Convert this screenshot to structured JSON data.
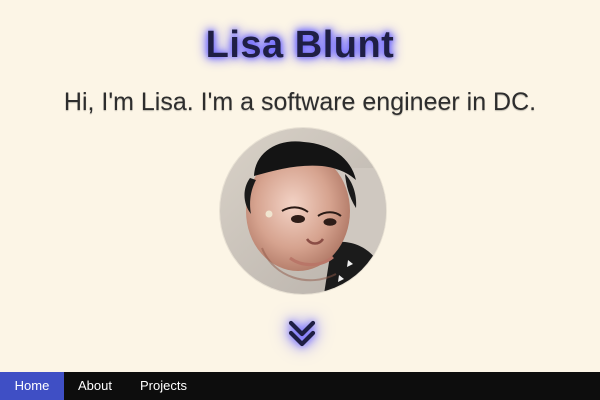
{
  "hero": {
    "name": "Lisa Blunt",
    "tagline": "Hi, I'm Lisa. I'm a software engineer in DC.",
    "avatar_alt": "Lisa Blunt",
    "scroll_icon": "double-chevron-down-icon"
  },
  "nav": {
    "items": [
      {
        "label": "Home",
        "active": true
      },
      {
        "label": "About",
        "active": false
      },
      {
        "label": "Projects",
        "active": false
      }
    ]
  },
  "colors": {
    "page_bg": "#fcf5e6",
    "title": "#1f1f45",
    "title_glow": "#6a63ff",
    "nav_bg": "#0d0d0d",
    "nav_active_bg": "#3f4fc5",
    "nav_text": "#ffffff"
  }
}
